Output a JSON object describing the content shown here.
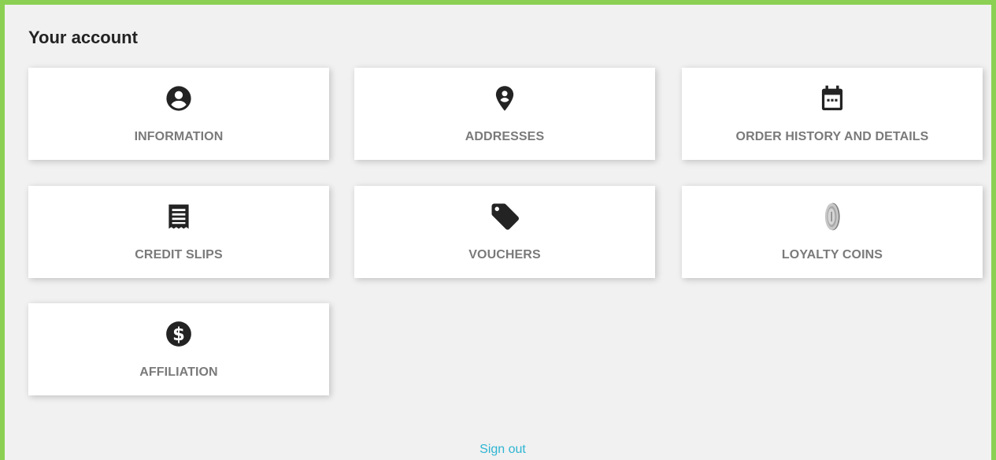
{
  "page": {
    "title": "Your account"
  },
  "tiles": [
    {
      "label": "Information",
      "icon": "account-circle-icon"
    },
    {
      "label": "Addresses",
      "icon": "location-pin-icon"
    },
    {
      "label": "Order history and details",
      "icon": "calendar-icon"
    },
    {
      "label": "Credit slips",
      "icon": "receipt-icon"
    },
    {
      "label": "Vouchers",
      "icon": "tag-icon"
    },
    {
      "label": "Loyalty coins",
      "icon": "coin-icon"
    },
    {
      "label": "Affiliation",
      "icon": "dollar-circle-icon"
    }
  ],
  "footer": {
    "signout_label": "Sign out"
  },
  "colors": {
    "frame_border": "#8bd052",
    "background": "#f1f1f1",
    "tile_background": "#ffffff",
    "label_text": "#7a7a7a",
    "link": "#2fb5d2"
  }
}
